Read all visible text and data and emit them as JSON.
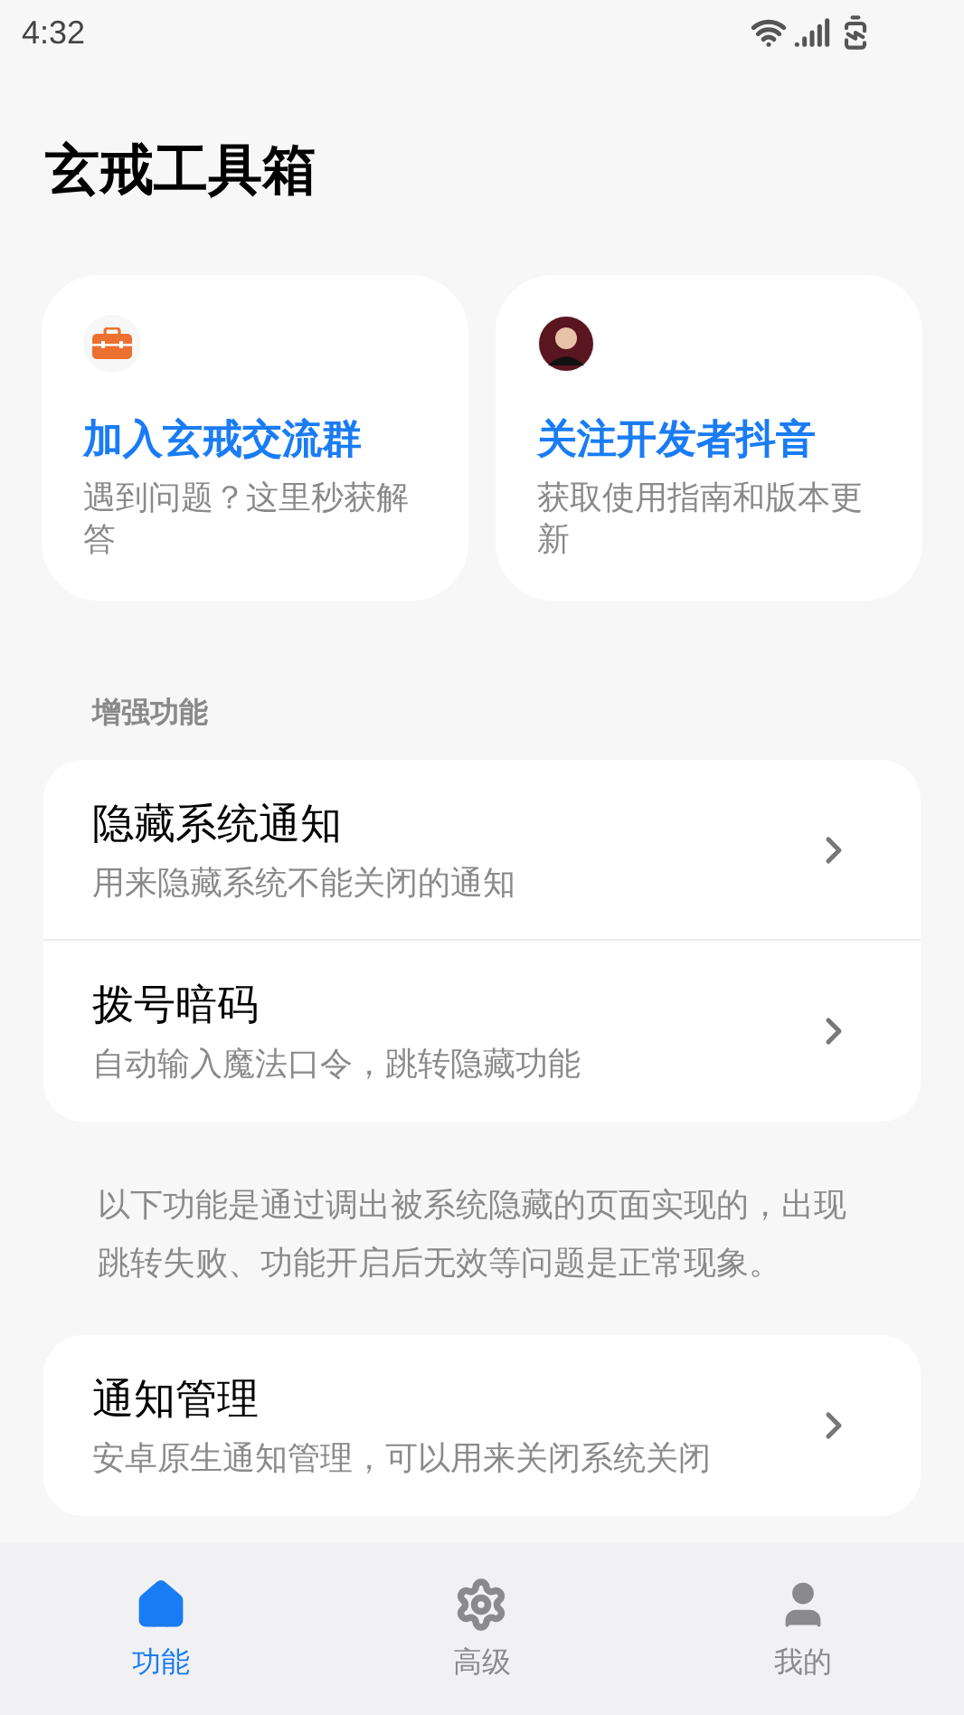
{
  "status_bar": {
    "time": "4:32"
  },
  "title": "玄戒工具箱",
  "cards": [
    {
      "kind": "toolbox",
      "title": "加入玄戒交流群",
      "subtitle": "遇到问题？这里秒获解答"
    },
    {
      "kind": "avatar",
      "title": "关注开发者抖音",
      "subtitle": "获取使用指南和版本更新"
    }
  ],
  "section_label": "增强功能",
  "enhanced_items": [
    {
      "title": "隐藏系统通知",
      "subtitle": "用来隐藏系统不能关闭的通知"
    },
    {
      "title": "拨号暗码",
      "subtitle": "自动输入魔法口令，跳转隐藏功能"
    }
  ],
  "note": "以下功能是通过调出被系统隐藏的页面实现的，出现跳转失败、功能开启后无效等问题是正常现象。",
  "more_items": [
    {
      "title": "通知管理",
      "subtitle": "安卓原生通知管理，可以用来关闭系统关闭"
    }
  ],
  "bottom_nav": [
    {
      "kind": "home",
      "label": "功能",
      "selected": true
    },
    {
      "kind": "settings",
      "label": "高级",
      "selected": false
    },
    {
      "kind": "user",
      "label": "我的",
      "selected": false
    }
  ]
}
